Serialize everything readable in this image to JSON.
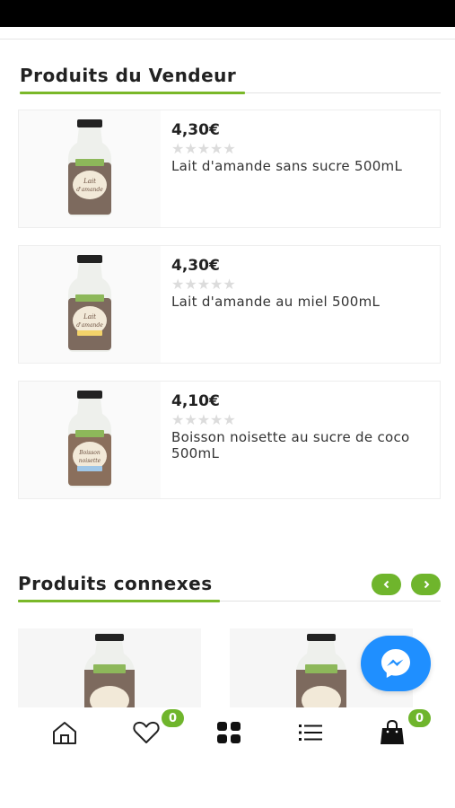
{
  "sections": {
    "vendor_title": "Produits du Vendeur",
    "related_title": "Produits connexes"
  },
  "vendor_products": [
    {
      "price": "4,30€",
      "stars": "★★★★★",
      "rating": 0,
      "name": "Lait d'amande sans sucre 500mL",
      "label_text": "Lait d'amande"
    },
    {
      "price": "4,30€",
      "stars": "★★★★★",
      "rating": 0,
      "name": "Lait d'amande au miel 500mL",
      "label_text": "Lait d'amande"
    },
    {
      "price": "4,10€",
      "stars": "★★★★★",
      "rating": 0,
      "name": "Boisson noisette au sucre de coco 500mL",
      "label_text": "Boisson noisette"
    }
  ],
  "related_products": [
    {
      "image": "bottle"
    },
    {
      "image": "bottle"
    }
  ],
  "bottom_nav": {
    "items": [
      "home-icon",
      "heart-icon",
      "grid-icon",
      "list-icon",
      "bag-icon"
    ],
    "wishlist_count": "0",
    "cart_count": "0"
  },
  "colors": {
    "accent": "#6fb52c",
    "messenger": "#1f8fff",
    "bottle_brown": "#7d6a5e",
    "bottle_cream": "#f2e9d8"
  }
}
